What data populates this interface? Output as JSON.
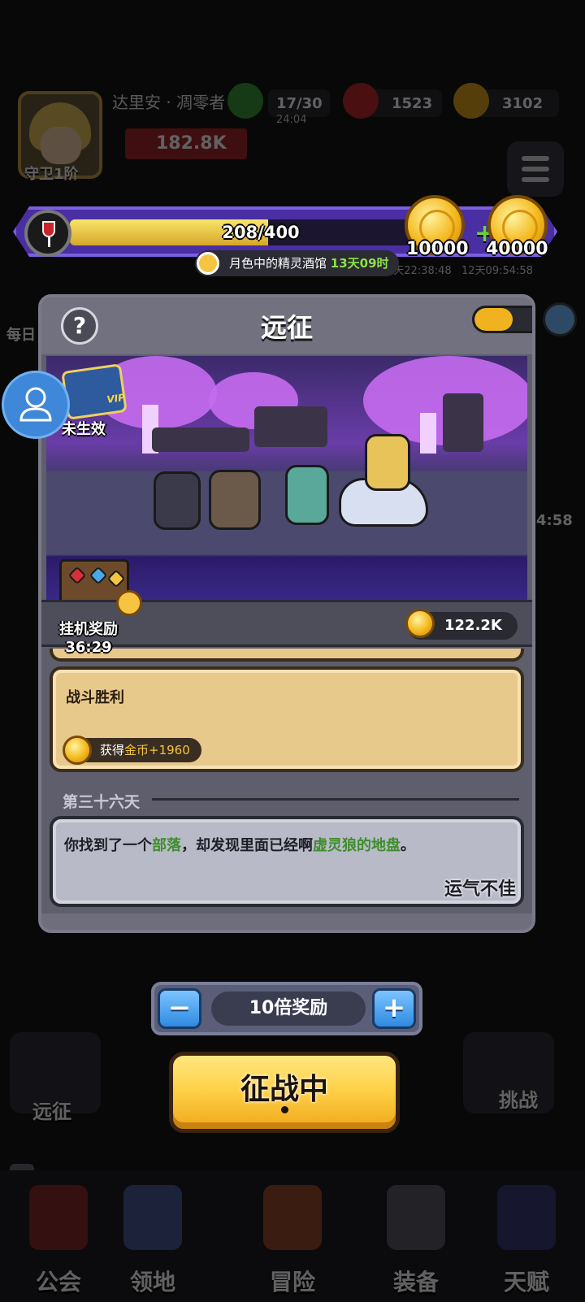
{
  "player": {
    "name": "达里安 · 凋零者",
    "rank": "守卫1阶",
    "power": "182.8K"
  },
  "resources": {
    "energy": "17/30",
    "energy_timer": "24:04",
    "gems": "1523",
    "gold": "3102"
  },
  "bg_side": {
    "daily": "每日",
    "right_timer": "4:58",
    "timer1": "7天22:38:48",
    "timer2": "12天09:54:58"
  },
  "tavern_bar": {
    "current": 208,
    "max": 400,
    "progress_text": "208/400",
    "reward_a": "10000",
    "reward_b": "40000",
    "event_name": "月色中的精灵酒馆",
    "event_time": "13天09时"
  },
  "expedition": {
    "title": "远征",
    "help": "?",
    "chest_progress": 0.55,
    "vip_badge": "VIP",
    "vip_status": "未生效",
    "afk_label": "挂机奖励",
    "afk_timer": "36:29",
    "afk_gold": "122.2K",
    "battle_log": {
      "title": "战斗胜利",
      "reward_prefix": "获得",
      "reward_item": "金币+1960"
    },
    "day_label": "第三十六天",
    "event": {
      "part1": "你找到了一个",
      "place": "部落",
      "part2": "，却发现里面已经啊",
      "territory": "虚灵狼的地盘",
      "part3": "。",
      "luck": "运气不佳"
    }
  },
  "multiplier": {
    "minus": "−",
    "plus": "+",
    "label": "10倍奖励"
  },
  "action_button": {
    "label": "征战中"
  },
  "side_buttons": {
    "left": "远征",
    "right": "挑战"
  },
  "nav": [
    {
      "label": "公会"
    },
    {
      "label": "领地"
    },
    {
      "label": "冒险"
    },
    {
      "label": "装备"
    },
    {
      "label": "天赋"
    }
  ],
  "colors": {
    "tavern_frame": "#4a2ea3",
    "energy_fill": "#f7e56a",
    "highlight_green": "#3e8e2a",
    "battle_button": "#ffd24a",
    "multiplier_button": "#2e8ae0"
  }
}
